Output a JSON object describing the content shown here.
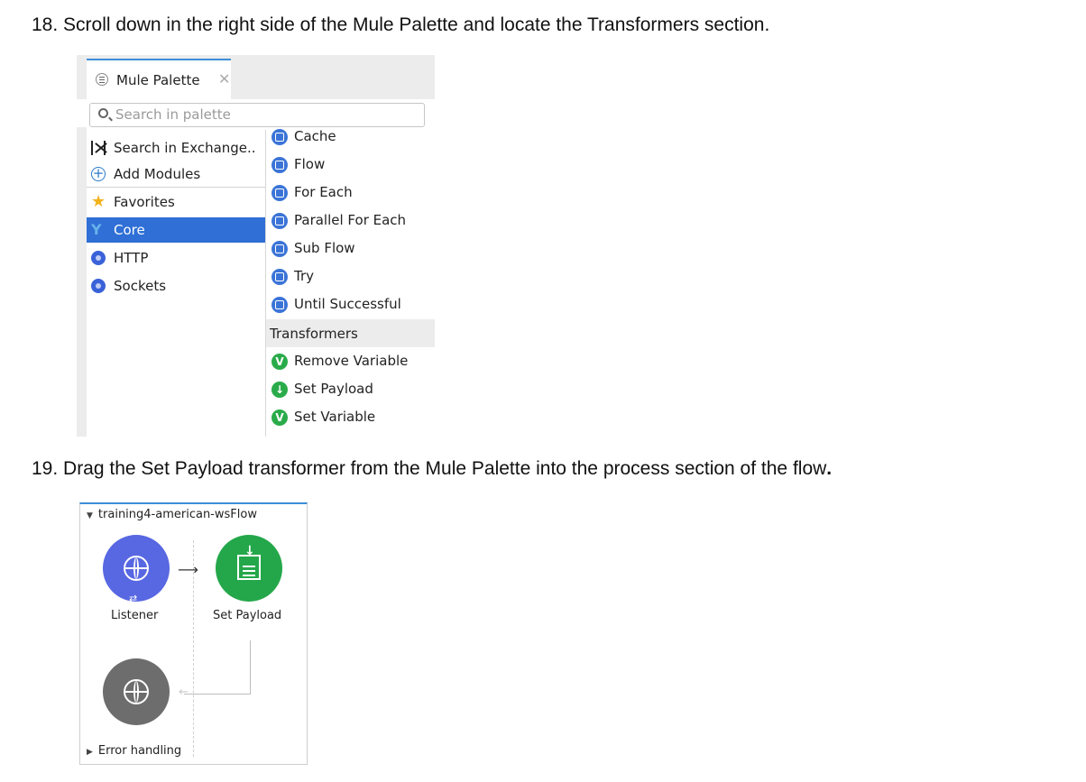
{
  "steps": {
    "step18": "18. Scroll down in the right side of the Mule Palette and locate the Transformers section.",
    "step19_main": "19. Drag the Set Payload transformer from the Mule Palette into the process section of the flow",
    "step19_end": "."
  },
  "palette": {
    "tab_label": "Mule Palette",
    "search_placeholder": "Search in palette",
    "left_items": [
      {
        "label": "Search in Exchange..",
        "icon": "exchange-icon"
      },
      {
        "label": "Add Modules",
        "icon": "add-icon"
      },
      {
        "label": "Favorites",
        "icon": "star-icon"
      },
      {
        "label": "Core",
        "icon": "core-icon",
        "selected": true
      },
      {
        "label": "HTTP",
        "icon": "http-icon"
      },
      {
        "label": "Sockets",
        "icon": "sockets-icon"
      }
    ],
    "right_items": [
      {
        "label": "Cache",
        "icon": "cache-icon"
      },
      {
        "label": "Flow",
        "icon": "flow-icon"
      },
      {
        "label": "For Each",
        "icon": "for-each-icon"
      },
      {
        "label": "Parallel For Each",
        "icon": "parallel-for-each-icon"
      },
      {
        "label": "Sub Flow",
        "icon": "sub-flow-icon"
      },
      {
        "label": "Try",
        "icon": "try-icon"
      },
      {
        "label": "Until Successful",
        "icon": "until-successful-icon"
      }
    ],
    "section_title": "Transformers",
    "transformers": [
      {
        "label": "Remove Variable",
        "icon": "remove-variable-icon",
        "glyph": "V"
      },
      {
        "label": "Set Payload",
        "icon": "set-payload-icon",
        "glyph": "↓"
      },
      {
        "label": "Set Variable",
        "icon": "set-variable-icon",
        "glyph": "V"
      }
    ],
    "colors": {
      "selected": "#2f6fd6",
      "core_blue": "#3b74d7",
      "transformer_green": "#2aab4a",
      "tab_accent": "#3c8ed8"
    }
  },
  "flow": {
    "title": "training4-american-wsFlow",
    "listener_label": "Listener",
    "set_payload_label": "Set Payload",
    "error_handling": "Error handling",
    "colors": {
      "listener": "#5867e2",
      "set_payload": "#24a74a",
      "error_handler": "#6d6d6d"
    }
  }
}
